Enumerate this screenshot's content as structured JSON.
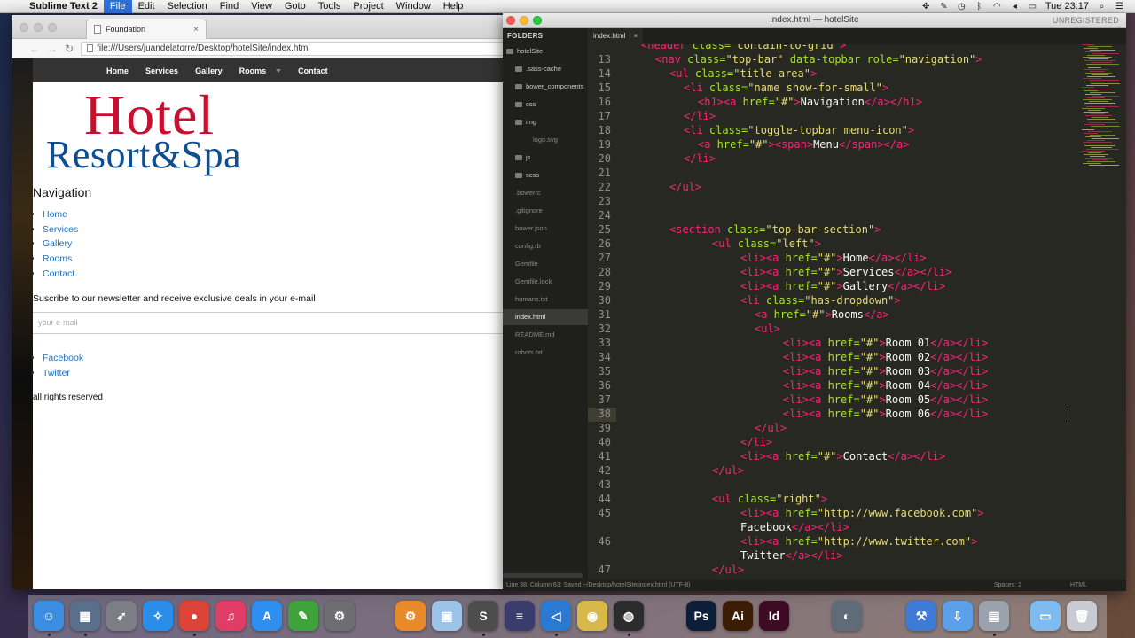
{
  "menubar": {
    "app": "Sublime Text 2",
    "items": [
      "File",
      "Edit",
      "Selection",
      "Find",
      "View",
      "Goto",
      "Tools",
      "Project",
      "Window",
      "Help"
    ],
    "active": "File",
    "time": "Tue 23:17"
  },
  "browser": {
    "tab_title": "Foundation",
    "url": "file:///Users/juandelatorre/Desktop/hotelSite/index.html"
  },
  "site": {
    "topbar": [
      "Home",
      "Services",
      "Gallery",
      "Rooms",
      "Contact"
    ],
    "logo_line1": "Hotel",
    "logo_line2": "Resort&Spa",
    "nav_heading": "Navigation",
    "nav_items": [
      "Home",
      "Services",
      "Gallery",
      "Rooms",
      "Contact"
    ],
    "newsletter": "Suscribe to our newsletter and receive exclusive deals in your e-mail",
    "email_placeholder": "your e-mail",
    "social": [
      "Facebook",
      "Twitter"
    ],
    "rights": "all rights reserved"
  },
  "editor": {
    "title": "index.html — hotelSite",
    "unregistered": "UNREGISTERED",
    "folders_label": "FOLDERS",
    "tab": "index.html",
    "sidebar": [
      {
        "name": "hotelSite",
        "type": "folder",
        "indent": 0
      },
      {
        "name": ".sass-cache",
        "type": "folder",
        "indent": 1
      },
      {
        "name": "bower_components",
        "type": "folder",
        "indent": 1
      },
      {
        "name": "css",
        "type": "folder",
        "indent": 1
      },
      {
        "name": "img",
        "type": "folder",
        "indent": 1
      },
      {
        "name": "logo.svg",
        "type": "file",
        "indent": 2
      },
      {
        "name": "js",
        "type": "folder",
        "indent": 1
      },
      {
        "name": "scss",
        "type": "folder",
        "indent": 1
      },
      {
        "name": ".bowerrc",
        "type": "file",
        "indent": 1
      },
      {
        "name": ".gitignore",
        "type": "file",
        "indent": 1
      },
      {
        "name": "bower.json",
        "type": "file",
        "indent": 1
      },
      {
        "name": "config.rb",
        "type": "file",
        "indent": 1
      },
      {
        "name": "Gemfile",
        "type": "file",
        "indent": 1
      },
      {
        "name": "Gemfile.lock",
        "type": "file",
        "indent": 1
      },
      {
        "name": "humans.txt",
        "type": "file",
        "indent": 1
      },
      {
        "name": "index.html",
        "type": "file",
        "indent": 1,
        "selected": true
      },
      {
        "name": "README.md",
        "type": "file",
        "indent": 1
      },
      {
        "name": "robots.txt",
        "type": "file",
        "indent": 1
      }
    ],
    "current_line": 38,
    "lines": [
      {
        "n": "",
        "indent": 4,
        "parts": [
          [
            "t",
            "<header"
          ],
          [
            "a",
            " class="
          ],
          [
            "s",
            "\"contain-to-grid\""
          ],
          [
            "t",
            ">"
          ]
        ]
      },
      {
        "n": "13",
        "indent": 6,
        "parts": [
          [
            "t",
            "<nav"
          ],
          [
            "a",
            " class="
          ],
          [
            "s",
            "\"top-bar\""
          ],
          [
            "a",
            " data-topbar"
          ],
          [
            "a",
            " role="
          ],
          [
            "s",
            "\"navigation\""
          ],
          [
            "t",
            ">"
          ]
        ]
      },
      {
        "n": "14",
        "indent": 8,
        "parts": [
          [
            "t",
            "<ul"
          ],
          [
            "a",
            " class="
          ],
          [
            "s",
            "\"title-area\""
          ],
          [
            "t",
            ">"
          ]
        ]
      },
      {
        "n": "15",
        "indent": 10,
        "parts": [
          [
            "t",
            "<li"
          ],
          [
            "a",
            " class="
          ],
          [
            "s",
            "\"name show-for-small\""
          ],
          [
            "t",
            ">"
          ]
        ]
      },
      {
        "n": "16",
        "indent": 12,
        "parts": [
          [
            "t",
            "<h1><a"
          ],
          [
            "a",
            " href="
          ],
          [
            "s",
            "\"#\""
          ],
          [
            "t",
            ">"
          ],
          [
            "p",
            "Navigation"
          ],
          [
            "t",
            "</a></h1>"
          ]
        ]
      },
      {
        "n": "17",
        "indent": 10,
        "parts": [
          [
            "t",
            "</li>"
          ]
        ]
      },
      {
        "n": "18",
        "indent": 10,
        "parts": [
          [
            "t",
            "<li"
          ],
          [
            "a",
            " class="
          ],
          [
            "s",
            "\"toggle-topbar menu-icon\""
          ],
          [
            "t",
            ">"
          ]
        ]
      },
      {
        "n": "19",
        "indent": 12,
        "parts": [
          [
            "t",
            "<a"
          ],
          [
            "a",
            " href="
          ],
          [
            "s",
            "\"#\""
          ],
          [
            "t",
            "><span>"
          ],
          [
            "p",
            "Menu"
          ],
          [
            "t",
            "</span></a>"
          ]
        ]
      },
      {
        "n": "20",
        "indent": 10,
        "parts": [
          [
            "t",
            "</li>"
          ]
        ]
      },
      {
        "n": "21",
        "indent": 0,
        "parts": []
      },
      {
        "n": "22",
        "indent": 8,
        "parts": [
          [
            "t",
            "</ul>"
          ]
        ]
      },
      {
        "n": "23",
        "indent": 0,
        "parts": []
      },
      {
        "n": "24",
        "indent": 0,
        "parts": []
      },
      {
        "n": "25",
        "indent": 8,
        "parts": [
          [
            "t",
            "<section"
          ],
          [
            "a",
            " class="
          ],
          [
            "s",
            "\"top-bar-section\""
          ],
          [
            "t",
            ">"
          ]
        ]
      },
      {
        "n": "26",
        "indent": 14,
        "parts": [
          [
            "t",
            "<ul"
          ],
          [
            "a",
            " class="
          ],
          [
            "s",
            "\"left\""
          ],
          [
            "t",
            ">"
          ]
        ]
      },
      {
        "n": "27",
        "indent": 18,
        "parts": [
          [
            "t",
            "<li><a"
          ],
          [
            "a",
            " href="
          ],
          [
            "s",
            "\"#\""
          ],
          [
            "t",
            ">"
          ],
          [
            "p",
            "Home"
          ],
          [
            "t",
            "</a></li>"
          ]
        ]
      },
      {
        "n": "28",
        "indent": 18,
        "parts": [
          [
            "t",
            "<li><a"
          ],
          [
            "a",
            " href="
          ],
          [
            "s",
            "\"#\""
          ],
          [
            "t",
            ">"
          ],
          [
            "p",
            "Services"
          ],
          [
            "t",
            "</a></li>"
          ]
        ]
      },
      {
        "n": "29",
        "indent": 18,
        "parts": [
          [
            "t",
            "<li><a"
          ],
          [
            "a",
            " href="
          ],
          [
            "s",
            "\"#\""
          ],
          [
            "t",
            ">"
          ],
          [
            "p",
            "Gallery"
          ],
          [
            "t",
            "</a></li>"
          ]
        ]
      },
      {
        "n": "30",
        "indent": 18,
        "parts": [
          [
            "t",
            "<li"
          ],
          [
            "a",
            " class="
          ],
          [
            "s",
            "\"has-dropdown\""
          ],
          [
            "t",
            ">"
          ]
        ]
      },
      {
        "n": "31",
        "indent": 20,
        "parts": [
          [
            "t",
            "<a"
          ],
          [
            "a",
            " href="
          ],
          [
            "s",
            "\"#\""
          ],
          [
            "t",
            ">"
          ],
          [
            "p",
            "Rooms"
          ],
          [
            "t",
            "</a>"
          ]
        ]
      },
      {
        "n": "32",
        "indent": 20,
        "parts": [
          [
            "t",
            "<ul>"
          ]
        ]
      },
      {
        "n": "33",
        "indent": 24,
        "parts": [
          [
            "t",
            "<li><a"
          ],
          [
            "a",
            " href="
          ],
          [
            "s",
            "\"#\""
          ],
          [
            "t",
            ">"
          ],
          [
            "p",
            "Room 01"
          ],
          [
            "t",
            "</a></li>"
          ]
        ]
      },
      {
        "n": "34",
        "indent": 24,
        "parts": [
          [
            "t",
            "<li><a"
          ],
          [
            "a",
            " href="
          ],
          [
            "s",
            "\"#\""
          ],
          [
            "t",
            ">"
          ],
          [
            "p",
            "Room 02"
          ],
          [
            "t",
            "</a></li>"
          ]
        ]
      },
      {
        "n": "35",
        "indent": 24,
        "parts": [
          [
            "t",
            "<li><a"
          ],
          [
            "a",
            " href="
          ],
          [
            "s",
            "\"#\""
          ],
          [
            "t",
            ">"
          ],
          [
            "p",
            "Room 03"
          ],
          [
            "t",
            "</a></li>"
          ]
        ]
      },
      {
        "n": "36",
        "indent": 24,
        "parts": [
          [
            "t",
            "<li><a"
          ],
          [
            "a",
            " href="
          ],
          [
            "s",
            "\"#\""
          ],
          [
            "t",
            ">"
          ],
          [
            "p",
            "Room 04"
          ],
          [
            "t",
            "</a></li>"
          ]
        ]
      },
      {
        "n": "37",
        "indent": 24,
        "parts": [
          [
            "t",
            "<li><a"
          ],
          [
            "a",
            " href="
          ],
          [
            "s",
            "\"#\""
          ],
          [
            "t",
            ">"
          ],
          [
            "p",
            "Room 05"
          ],
          [
            "t",
            "</a></li>"
          ]
        ]
      },
      {
        "n": "38",
        "indent": 24,
        "parts": [
          [
            "t",
            "<li><a"
          ],
          [
            "a",
            " href="
          ],
          [
            "s",
            "\"#\""
          ],
          [
            "t",
            ">"
          ],
          [
            "p",
            "Room 06"
          ],
          [
            "t",
            "</a></li>"
          ]
        ]
      },
      {
        "n": "39",
        "indent": 20,
        "parts": [
          [
            "t",
            "</ul>"
          ]
        ]
      },
      {
        "n": "40",
        "indent": 18,
        "parts": [
          [
            "t",
            "</li>"
          ]
        ]
      },
      {
        "n": "41",
        "indent": 18,
        "parts": [
          [
            "t",
            "<li><a"
          ],
          [
            "a",
            " href="
          ],
          [
            "s",
            "\"#\""
          ],
          [
            "t",
            ">"
          ],
          [
            "p",
            "Contact"
          ],
          [
            "t",
            "</a></li>"
          ]
        ]
      },
      {
        "n": "42",
        "indent": 14,
        "parts": [
          [
            "t",
            "</ul>"
          ]
        ]
      },
      {
        "n": "43",
        "indent": 0,
        "parts": []
      },
      {
        "n": "44",
        "indent": 14,
        "parts": [
          [
            "t",
            "<ul"
          ],
          [
            "a",
            " class="
          ],
          [
            "s",
            "\"right\""
          ],
          [
            "t",
            ">"
          ]
        ]
      },
      {
        "n": "45",
        "indent": 18,
        "parts": [
          [
            "t",
            "<li><a"
          ],
          [
            "a",
            " href="
          ],
          [
            "s",
            "\"http://www.facebook.com\""
          ],
          [
            "t",
            ">"
          ]
        ]
      },
      {
        "n": "",
        "indent": 18,
        "parts": [
          [
            "p",
            "Facebook"
          ],
          [
            "t",
            "</a></li>"
          ]
        ]
      },
      {
        "n": "46",
        "indent": 18,
        "parts": [
          [
            "t",
            "<li><a"
          ],
          [
            "a",
            " href="
          ],
          [
            "s",
            "\"http://www.twitter.com\""
          ],
          [
            "t",
            ">"
          ]
        ]
      },
      {
        "n": "",
        "indent": 18,
        "parts": [
          [
            "p",
            "Twitter"
          ],
          [
            "t",
            "</a></li>"
          ]
        ]
      },
      {
        "n": "47",
        "indent": 14,
        "parts": [
          [
            "t",
            "</ul>"
          ]
        ]
      }
    ],
    "status": "Line 38, Column 63; Saved ~/Desktop/hotelSite/index.html (UTF-8)",
    "spaces": "Spaces: 2",
    "syntax": "HTML"
  },
  "dock": [
    {
      "name": "finder-icon",
      "color": "#3a8de0",
      "glyph": "☺"
    },
    {
      "name": "photo-icon",
      "color": "#5a6f8c",
      "glyph": "▦"
    },
    {
      "name": "launchpad-icon",
      "color": "#7d7d85",
      "glyph": "➶"
    },
    {
      "name": "safari-icon",
      "color": "#2a8de8",
      "glyph": "✧"
    },
    {
      "name": "chrome-icon",
      "color": "#db4437",
      "glyph": "●"
    },
    {
      "name": "itunes-icon",
      "color": "#e13c66",
      "glyph": "♫"
    },
    {
      "name": "app-store-icon",
      "color": "#2f8ff0",
      "glyph": "A"
    },
    {
      "name": "evernote-icon",
      "color": "#3fa33b",
      "glyph": "✎"
    },
    {
      "name": "system-preferences-icon",
      "color": "#6d6d72",
      "glyph": "⚙"
    },
    {
      "name": "utility-icon",
      "color": "#e98a2a",
      "glyph": "⚙"
    },
    {
      "name": "box-icon",
      "color": "#9cc4e8",
      "glyph": "▣"
    },
    {
      "name": "sublime-icon",
      "color": "#4d4d4d",
      "glyph": "S"
    },
    {
      "name": "stripes-icon",
      "color": "#3b3c6e",
      "glyph": "≡"
    },
    {
      "name": "visual-studio-code-icon",
      "color": "#2b7ad1",
      "glyph": "◁"
    },
    {
      "name": "database-icon",
      "color": "#d8b84a",
      "glyph": "◉"
    },
    {
      "name": "github-icon",
      "color": "#2c2c2c",
      "glyph": "◍"
    },
    {
      "name": "photoshop-icon",
      "color": "#0d1e3b",
      "glyph": "Ps"
    },
    {
      "name": "illustrator-icon",
      "color": "#3b1c04",
      "glyph": "Ai"
    },
    {
      "name": "indesign-icon",
      "color": "#3d0b23",
      "glyph": "Id"
    },
    {
      "name": "sequel-pro-icon",
      "color": "#5f6b76",
      "glyph": "◐"
    },
    {
      "name": "xcode-icon",
      "color": "#3d7bd6",
      "glyph": "⚒"
    },
    {
      "name": "downloads-stack-icon",
      "color": "#5ba0e8",
      "glyph": "⇩"
    },
    {
      "name": "preview-icon",
      "color": "#9aa3ad",
      "glyph": "▤"
    },
    {
      "name": "folder-icon",
      "color": "#7dbbf0",
      "glyph": "▭"
    },
    {
      "name": "trash-icon",
      "color": "#c8ccd2",
      "glyph": "🗑"
    }
  ]
}
